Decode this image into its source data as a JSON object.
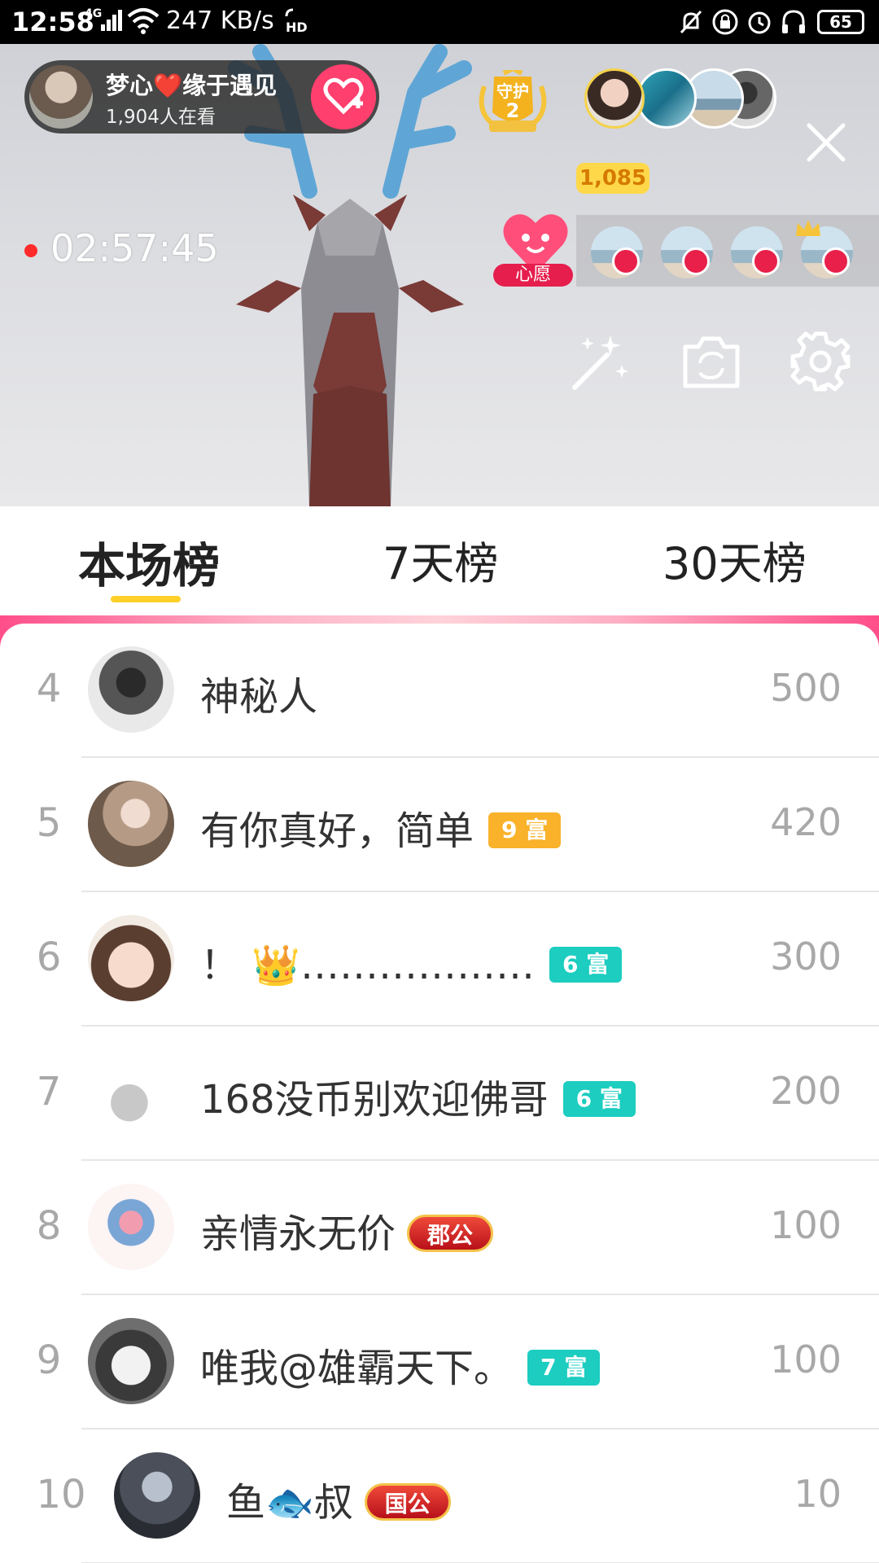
{
  "status_bar": {
    "time": "12:58",
    "network": "4G",
    "speed": "247 KB/s",
    "battery": "65"
  },
  "live": {
    "host_name": "梦心❤️缘于遇见",
    "viewers_online": "1,904人在看",
    "timer": "02:57:45",
    "guard": {
      "label": "守护",
      "count": "2"
    },
    "audience_count": "1,085",
    "wish_label": "心愿"
  },
  "tabs": [
    {
      "label": "本场榜",
      "active": true
    },
    {
      "label": "7天榜",
      "active": false
    },
    {
      "label": "30天榜",
      "active": false
    }
  ],
  "ranking": [
    {
      "rank": "4",
      "name": "神秘人",
      "badge": "",
      "badge_type": "",
      "score": "500"
    },
    {
      "rank": "5",
      "name": "有你真好，简单",
      "badge": "9 富",
      "badge_type": "rich-gold",
      "score": "420"
    },
    {
      "rank": "6",
      "name": "！ 👑………………",
      "badge": "6 富",
      "badge_type": "rich-teal",
      "score": "300"
    },
    {
      "rank": "7",
      "name": "168没币别欢迎佛哥",
      "badge": "6 富",
      "badge_type": "rich-teal",
      "score": "200"
    },
    {
      "rank": "8",
      "name": "亲情永无价",
      "badge": "郡公",
      "badge_type": "noble",
      "score": "100"
    },
    {
      "rank": "9",
      "name": "唯我@雄霸天下。",
      "badge": "7 富",
      "badge_type": "rich-teal",
      "score": "100"
    },
    {
      "rank": "10",
      "name": "鱼🐟叔",
      "badge": "国公",
      "badge_type": "noble",
      "score": "10"
    }
  ],
  "colors": {
    "accent_yellow": "#ffd028",
    "rich_gold": "#f9b22a",
    "rich_teal": "#1ccdc0",
    "live_red": "#ff2a2a",
    "follow_pink": "#ff3f6e"
  },
  "icons": {
    "close": "close-icon",
    "magic": "magic-wand-icon",
    "camera": "camera-switch-icon",
    "settings": "gear-icon"
  }
}
